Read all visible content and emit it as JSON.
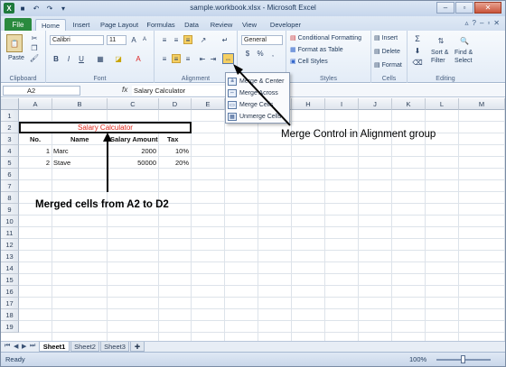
{
  "window": {
    "title": "sample.workbook.xlsx - Microsoft Excel"
  },
  "tabs": [
    {
      "label": "File"
    },
    {
      "label": "Home"
    },
    {
      "label": "Insert"
    },
    {
      "label": "Page Layout"
    },
    {
      "label": "Formulas"
    },
    {
      "label": "Data"
    },
    {
      "label": "Review"
    },
    {
      "label": "View"
    },
    {
      "label": "Developer"
    }
  ],
  "ribbon": {
    "clipboard": {
      "label": "Clipboard",
      "paste": "Paste"
    },
    "font": {
      "label": "Font",
      "name": "Calibri",
      "size": "11"
    },
    "alignment": {
      "label": "Alignment"
    },
    "number": {
      "format": "General"
    },
    "styles": {
      "label": "Styles",
      "conditional": "Conditional Formatting",
      "format_table": "Format as Table",
      "cell_styles": "Cell Styles"
    },
    "cells": {
      "label": "Cells",
      "insert": "Insert",
      "delete": "Delete",
      "format": "Format"
    },
    "editing": {
      "label": "Editing",
      "sort": "Sort &",
      "filter": "Filter",
      "find": "Find &",
      "select": "Select"
    }
  },
  "formula_bar": {
    "name_box": "A2",
    "fx": "fx",
    "content": "Salary Calculator"
  },
  "merge_menu": [
    {
      "label": "Merge & Center"
    },
    {
      "label": "Merge Across"
    },
    {
      "label": "Merge Cells"
    },
    {
      "label": "Unmerge Cells"
    }
  ],
  "columns": [
    "A",
    "B",
    "C",
    "D",
    "E",
    "F",
    "G",
    "H",
    "I",
    "J",
    "K",
    "L",
    "M"
  ],
  "rows": [
    "1",
    "2",
    "3",
    "4",
    "5",
    "6",
    "7",
    "8",
    "9",
    "10",
    "11",
    "12",
    "13",
    "14",
    "15",
    "16",
    "17",
    "18",
    "19"
  ],
  "sheet": {
    "merged_title": "Salary Calculator",
    "headers": [
      "No.",
      "Name",
      "Salary Amount",
      "Tax"
    ],
    "data": [
      {
        "no": "1",
        "name": "Marc",
        "salary": "2000",
        "tax": "10%"
      },
      {
        "no": "2",
        "name": "Stave",
        "salary": "50000",
        "tax": "20%"
      }
    ]
  },
  "annotations": {
    "merge_control": "Merge Control in Alignment group",
    "merged_cells": "Merged cells from A2 to D2"
  },
  "sheets": [
    "Sheet1",
    "Sheet2",
    "Sheet3"
  ],
  "status": {
    "ready": "Ready",
    "zoom": "100%"
  }
}
